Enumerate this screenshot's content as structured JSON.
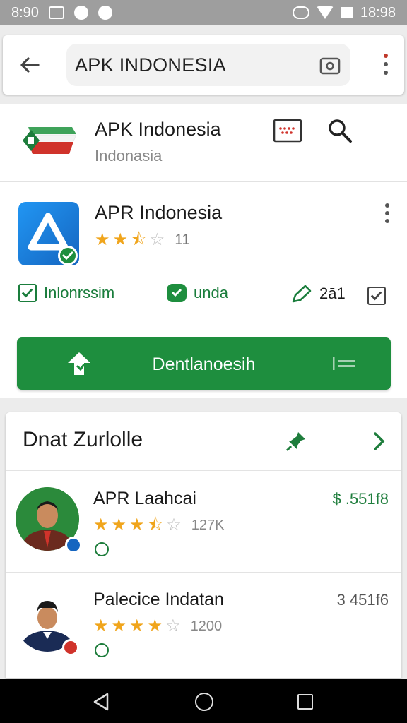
{
  "status_bar": {
    "time_left": "8:90",
    "time_right": "18:98"
  },
  "search": {
    "query": "APK INDONESIA",
    "back_icon": "arrow-left-icon",
    "camera_icon": "camera-icon",
    "menu_icon": "more-vert-icon"
  },
  "header": {
    "title": "APK Indonesia",
    "subtitle": "Indonasia",
    "keyboard_icon": "keyboard-icon",
    "search_icon": "search-icon"
  },
  "app": {
    "title": "APR Indonesia",
    "rating": 2.5,
    "rating_count": "11",
    "meta": [
      {
        "icon": "check-square-icon",
        "label": "Inlonrssim"
      },
      {
        "icon": "chat-icon",
        "label": "unda"
      },
      {
        "icon": "pen-icon",
        "label": "2ā1"
      }
    ],
    "install_label": "Dentlanoesih"
  },
  "list": {
    "title": "Dnat Zurlolle",
    "items": [
      {
        "title": "APR Laahcai",
        "rating": 3.5,
        "count": "127K",
        "price": "$ .551f8"
      },
      {
        "title": "Palecice Indatan",
        "rating": 4,
        "count": "1200",
        "price": "3 451f6"
      }
    ]
  },
  "colors": {
    "accent_green": "#1e8e3e",
    "star_gold": "#f0a51c",
    "app_blue": "#1e88e5"
  }
}
